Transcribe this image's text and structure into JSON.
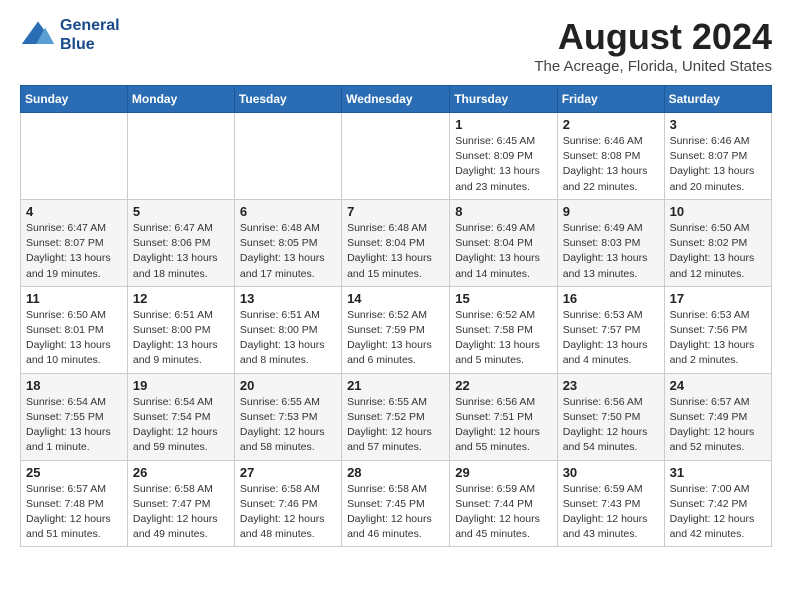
{
  "logo": {
    "line1": "General",
    "line2": "Blue"
  },
  "title": "August 2024",
  "subtitle": "The Acreage, Florida, United States",
  "days_of_week": [
    "Sunday",
    "Monday",
    "Tuesday",
    "Wednesday",
    "Thursday",
    "Friday",
    "Saturday"
  ],
  "weeks": [
    [
      {
        "day": "",
        "info": ""
      },
      {
        "day": "",
        "info": ""
      },
      {
        "day": "",
        "info": ""
      },
      {
        "day": "",
        "info": ""
      },
      {
        "day": "1",
        "info": "Sunrise: 6:45 AM\nSunset: 8:09 PM\nDaylight: 13 hours\nand 23 minutes."
      },
      {
        "day": "2",
        "info": "Sunrise: 6:46 AM\nSunset: 8:08 PM\nDaylight: 13 hours\nand 22 minutes."
      },
      {
        "day": "3",
        "info": "Sunrise: 6:46 AM\nSunset: 8:07 PM\nDaylight: 13 hours\nand 20 minutes."
      }
    ],
    [
      {
        "day": "4",
        "info": "Sunrise: 6:47 AM\nSunset: 8:07 PM\nDaylight: 13 hours\nand 19 minutes."
      },
      {
        "day": "5",
        "info": "Sunrise: 6:47 AM\nSunset: 8:06 PM\nDaylight: 13 hours\nand 18 minutes."
      },
      {
        "day": "6",
        "info": "Sunrise: 6:48 AM\nSunset: 8:05 PM\nDaylight: 13 hours\nand 17 minutes."
      },
      {
        "day": "7",
        "info": "Sunrise: 6:48 AM\nSunset: 8:04 PM\nDaylight: 13 hours\nand 15 minutes."
      },
      {
        "day": "8",
        "info": "Sunrise: 6:49 AM\nSunset: 8:04 PM\nDaylight: 13 hours\nand 14 minutes."
      },
      {
        "day": "9",
        "info": "Sunrise: 6:49 AM\nSunset: 8:03 PM\nDaylight: 13 hours\nand 13 minutes."
      },
      {
        "day": "10",
        "info": "Sunrise: 6:50 AM\nSunset: 8:02 PM\nDaylight: 13 hours\nand 12 minutes."
      }
    ],
    [
      {
        "day": "11",
        "info": "Sunrise: 6:50 AM\nSunset: 8:01 PM\nDaylight: 13 hours\nand 10 minutes."
      },
      {
        "day": "12",
        "info": "Sunrise: 6:51 AM\nSunset: 8:00 PM\nDaylight: 13 hours\nand 9 minutes."
      },
      {
        "day": "13",
        "info": "Sunrise: 6:51 AM\nSunset: 8:00 PM\nDaylight: 13 hours\nand 8 minutes."
      },
      {
        "day": "14",
        "info": "Sunrise: 6:52 AM\nSunset: 7:59 PM\nDaylight: 13 hours\nand 6 minutes."
      },
      {
        "day": "15",
        "info": "Sunrise: 6:52 AM\nSunset: 7:58 PM\nDaylight: 13 hours\nand 5 minutes."
      },
      {
        "day": "16",
        "info": "Sunrise: 6:53 AM\nSunset: 7:57 PM\nDaylight: 13 hours\nand 4 minutes."
      },
      {
        "day": "17",
        "info": "Sunrise: 6:53 AM\nSunset: 7:56 PM\nDaylight: 13 hours\nand 2 minutes."
      }
    ],
    [
      {
        "day": "18",
        "info": "Sunrise: 6:54 AM\nSunset: 7:55 PM\nDaylight: 13 hours\nand 1 minute."
      },
      {
        "day": "19",
        "info": "Sunrise: 6:54 AM\nSunset: 7:54 PM\nDaylight: 12 hours\nand 59 minutes."
      },
      {
        "day": "20",
        "info": "Sunrise: 6:55 AM\nSunset: 7:53 PM\nDaylight: 12 hours\nand 58 minutes."
      },
      {
        "day": "21",
        "info": "Sunrise: 6:55 AM\nSunset: 7:52 PM\nDaylight: 12 hours\nand 57 minutes."
      },
      {
        "day": "22",
        "info": "Sunrise: 6:56 AM\nSunset: 7:51 PM\nDaylight: 12 hours\nand 55 minutes."
      },
      {
        "day": "23",
        "info": "Sunrise: 6:56 AM\nSunset: 7:50 PM\nDaylight: 12 hours\nand 54 minutes."
      },
      {
        "day": "24",
        "info": "Sunrise: 6:57 AM\nSunset: 7:49 PM\nDaylight: 12 hours\nand 52 minutes."
      }
    ],
    [
      {
        "day": "25",
        "info": "Sunrise: 6:57 AM\nSunset: 7:48 PM\nDaylight: 12 hours\nand 51 minutes."
      },
      {
        "day": "26",
        "info": "Sunrise: 6:58 AM\nSunset: 7:47 PM\nDaylight: 12 hours\nand 49 minutes."
      },
      {
        "day": "27",
        "info": "Sunrise: 6:58 AM\nSunset: 7:46 PM\nDaylight: 12 hours\nand 48 minutes."
      },
      {
        "day": "28",
        "info": "Sunrise: 6:58 AM\nSunset: 7:45 PM\nDaylight: 12 hours\nand 46 minutes."
      },
      {
        "day": "29",
        "info": "Sunrise: 6:59 AM\nSunset: 7:44 PM\nDaylight: 12 hours\nand 45 minutes."
      },
      {
        "day": "30",
        "info": "Sunrise: 6:59 AM\nSunset: 7:43 PM\nDaylight: 12 hours\nand 43 minutes."
      },
      {
        "day": "31",
        "info": "Sunrise: 7:00 AM\nSunset: 7:42 PM\nDaylight: 12 hours\nand 42 minutes."
      }
    ]
  ]
}
